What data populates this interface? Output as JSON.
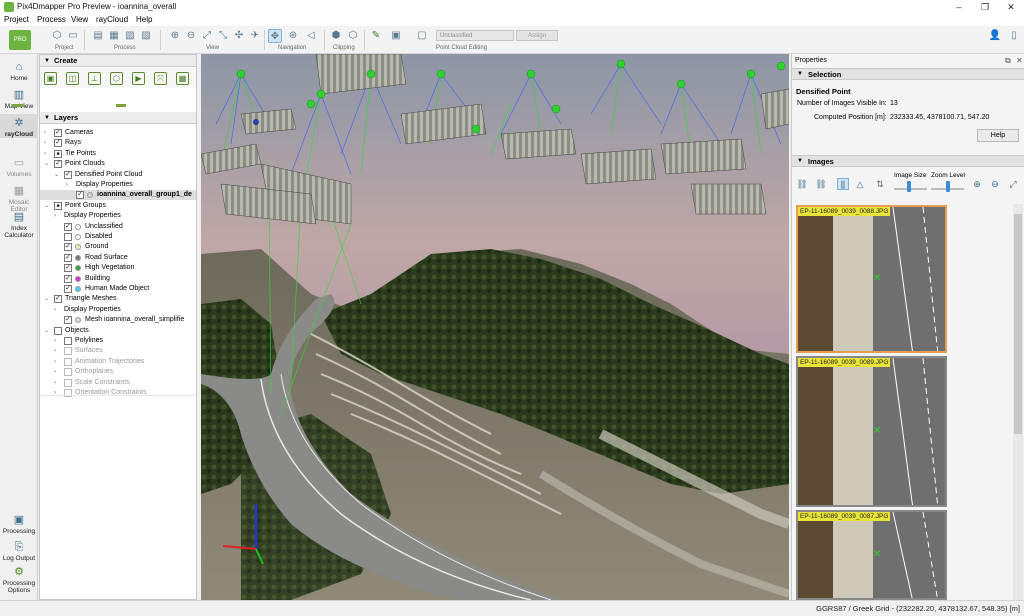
{
  "window": {
    "title": "Pix4Dmapper Pro Preview - ioannina_overall"
  },
  "menu": [
    "Project",
    "Process",
    "View",
    "rayCloud",
    "Help"
  ],
  "toolbar": {
    "groups": [
      "Project",
      "Process",
      "View",
      "Navigation",
      "Clipping",
      "Point Cloud Editing"
    ],
    "class_combo": "Unclassified",
    "assign_label": "Assign"
  },
  "leftnav": {
    "top": [
      {
        "label": "Home",
        "icon": "home-icon"
      },
      {
        "label": "Map View",
        "icon": "map-icon"
      },
      {
        "label": "rayCloud",
        "icon": "raycloud-icon",
        "selected": true
      },
      {
        "label": "Volumes",
        "icon": "volumes-icon",
        "disabled": true
      },
      {
        "label": "Mosaic Editor",
        "icon": "mosaic-icon",
        "disabled": true
      },
      {
        "label": "Index Calculator",
        "icon": "index-calculator-icon"
      }
    ],
    "bottom": [
      {
        "label": "Processing",
        "icon": "processing-icon"
      },
      {
        "label": "Log Output",
        "icon": "log-icon"
      },
      {
        "label": "Processing Options",
        "icon": "gear-icon"
      }
    ]
  },
  "panel": {
    "create_title": "Create",
    "layers_title": "Layers"
  },
  "layers": [
    {
      "label": "Cameras",
      "depth": 0,
      "arrow": "›",
      "check": true
    },
    {
      "label": "Rays",
      "depth": 0,
      "arrow": "›",
      "check": true
    },
    {
      "label": "Tie Points",
      "depth": 0,
      "arrow": "›",
      "check": "partial"
    },
    {
      "label": "Point Clouds",
      "depth": 0,
      "arrow": "⌄",
      "check": true
    },
    {
      "label": "Densified Point Cloud",
      "depth": 1,
      "arrow": "⌄",
      "check": true
    },
    {
      "label": "Display Properties",
      "depth": 2,
      "arrow": "›"
    },
    {
      "label": "ioannina_overall_group1_de",
      "depth": 2,
      "check": true,
      "icon": true,
      "bold": true,
      "highlight": true
    },
    {
      "label": "Point Groups",
      "depth": 0,
      "arrow": "⌄",
      "check": "partial"
    },
    {
      "label": "Display Properties",
      "depth": 1,
      "arrow": "›"
    },
    {
      "label": "Unclassified",
      "depth": 1,
      "check": true,
      "dot": "#ffffff"
    },
    {
      "label": "Disabled",
      "depth": 1,
      "check": false,
      "dot": "#ffffff"
    },
    {
      "label": "Ground",
      "depth": 1,
      "check": true,
      "dot": "#f1e9b0"
    },
    {
      "label": "Road Surface",
      "depth": 1,
      "check": true,
      "dot": "#7a7a7a"
    },
    {
      "label": "High Vegetation",
      "depth": 1,
      "check": true,
      "dot": "#3aa13a"
    },
    {
      "label": "Building",
      "depth": 1,
      "check": true,
      "dot": "#c83ad6"
    },
    {
      "label": "Human Made Object",
      "depth": 1,
      "check": true,
      "dot": "#44d2e6"
    },
    {
      "label": "Triangle Meshes",
      "depth": 0,
      "arrow": "⌄",
      "check": true
    },
    {
      "label": "Display Properties",
      "depth": 1,
      "arrow": "›"
    },
    {
      "label": "Mesh ioannina_overall_simplifie",
      "depth": 1,
      "check": true,
      "icon": true
    },
    {
      "label": "Objects",
      "depth": 0,
      "arrow": "⌄",
      "check": false
    },
    {
      "label": "Polylines",
      "depth": 1,
      "arrow": "›",
      "check": false
    },
    {
      "label": "Surfaces",
      "depth": 1,
      "arrow": "›",
      "check": false,
      "dim": true
    },
    {
      "label": "Animation Trajectories",
      "depth": 1,
      "arrow": "›",
      "check": false,
      "dim": true
    },
    {
      "label": "Orthoplanes",
      "depth": 1,
      "arrow": "›",
      "check": false,
      "dim": true
    },
    {
      "label": "Scale Constraints",
      "depth": 1,
      "arrow": "›",
      "check": false,
      "dim": true
    },
    {
      "label": "Orientation Constraints",
      "depth": 1,
      "arrow": "›",
      "check": false,
      "dim": true
    }
  ],
  "properties": {
    "title": "Properties",
    "selection_title": "Selection",
    "point_type": "Densified Point",
    "images_visible_label": "Number of Images Visible In:",
    "images_visible_value": "13",
    "computed_label": "Computed Position [m]:",
    "computed_value": "232333.45, 4378100.71, 547.20",
    "help_label": "Help",
    "images_title": "Images",
    "image_size_label": "Image Size",
    "zoom_level_label": "Zoom Level",
    "image_size_level": 0.45,
    "zoom_level_level": 0.5,
    "thumbnails": [
      {
        "name": "EP-11-16089_0039_0088.JPG",
        "selected": true
      },
      {
        "name": "EP-11-16089_0039_0089.JPG",
        "selected": false
      },
      {
        "name": "EP-11-16089_0039_0087.JPG",
        "selected": false
      }
    ]
  },
  "status": {
    "coords": "GGRS87 / Greek Grid - (232282.20, 4378132.67, 548.35) [m]"
  }
}
